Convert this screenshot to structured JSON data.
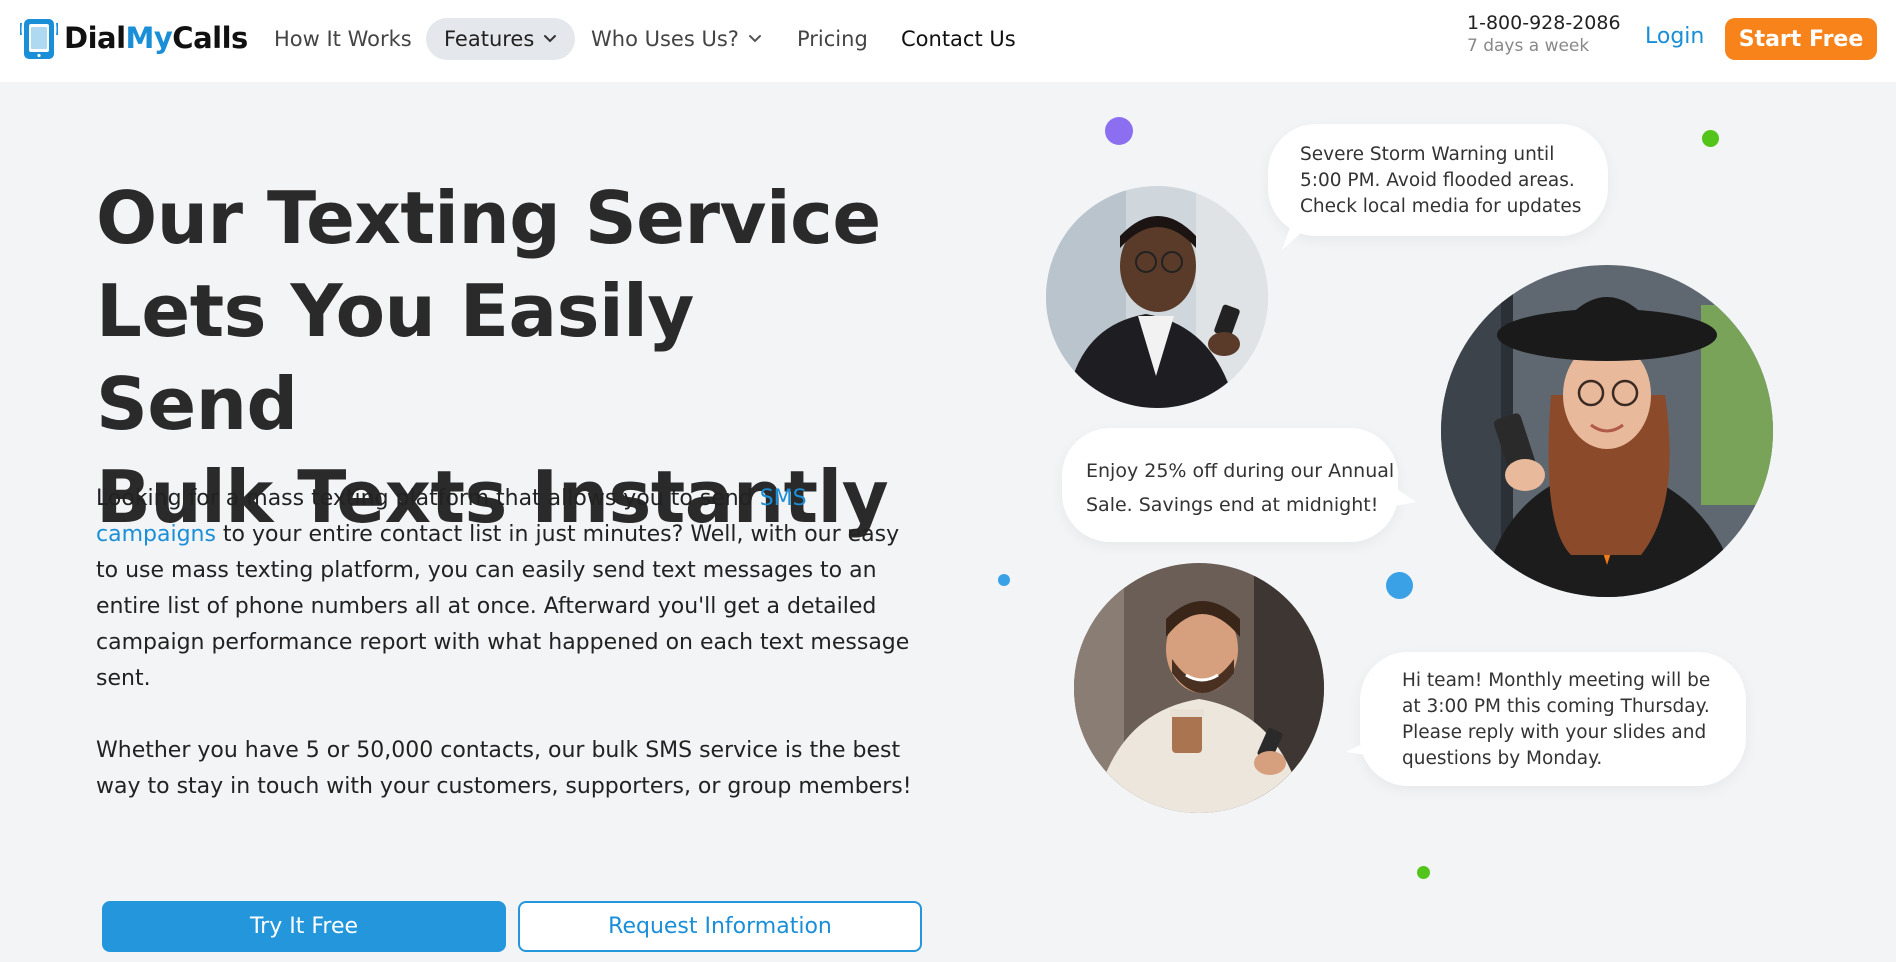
{
  "header": {
    "logo": {
      "part1": "Dial",
      "part2": "My",
      "part3": "Calls"
    },
    "nav": [
      {
        "label": "How It Works"
      },
      {
        "label": "Features"
      },
      {
        "label": "Who Uses Us?"
      },
      {
        "label": "Pricing"
      },
      {
        "label": "Contact Us"
      }
    ],
    "phone": "1-800-928-2086",
    "phone_hours": "7 days a week",
    "login": "Login",
    "start_free": "Start Free"
  },
  "hero": {
    "headline_lines": [
      "Our Texting Service",
      "Lets You Easily Send",
      "Bulk Texts Instantly"
    ],
    "p1_before": "Looking for a mass texting platform that allows you to send ",
    "p1_link": "SMS campaigns",
    "p1_after": " to your entire contact list in just minutes? Well, with our easy to use mass texting platform, you can easily send text messages to an entire list of phone numbers all at once. Afterward you'll get a detailed campaign performance report with what happened on each text message sent.",
    "p2": "Whether you have 5 or 50,000 contacts, our bulk SMS service is the best way to stay in touch with your customers, supporters, or group members!",
    "try_button": "Try It Free",
    "request_button": "Request Information"
  },
  "illustration": {
    "bubbles": [
      {
        "lines": [
          "Severe Storm Warning until",
          "5:00 PM. Avoid flooded areas.",
          "Check local media for updates"
        ]
      },
      {
        "lines": [
          "Enjoy 25% off during our Annual",
          "Sale. Savings end at midnight!"
        ]
      },
      {
        "lines": [
          "Hi team! Monthly meeting will be",
          "at 3:00 PM this coming Thursday.",
          "Please reply with your slides and",
          "questions by Monday."
        ]
      }
    ],
    "colors": {
      "purple_dot": "#8b6ff0",
      "green_dot": "#52c41a",
      "blue_dot": "#3aa1e6"
    }
  }
}
